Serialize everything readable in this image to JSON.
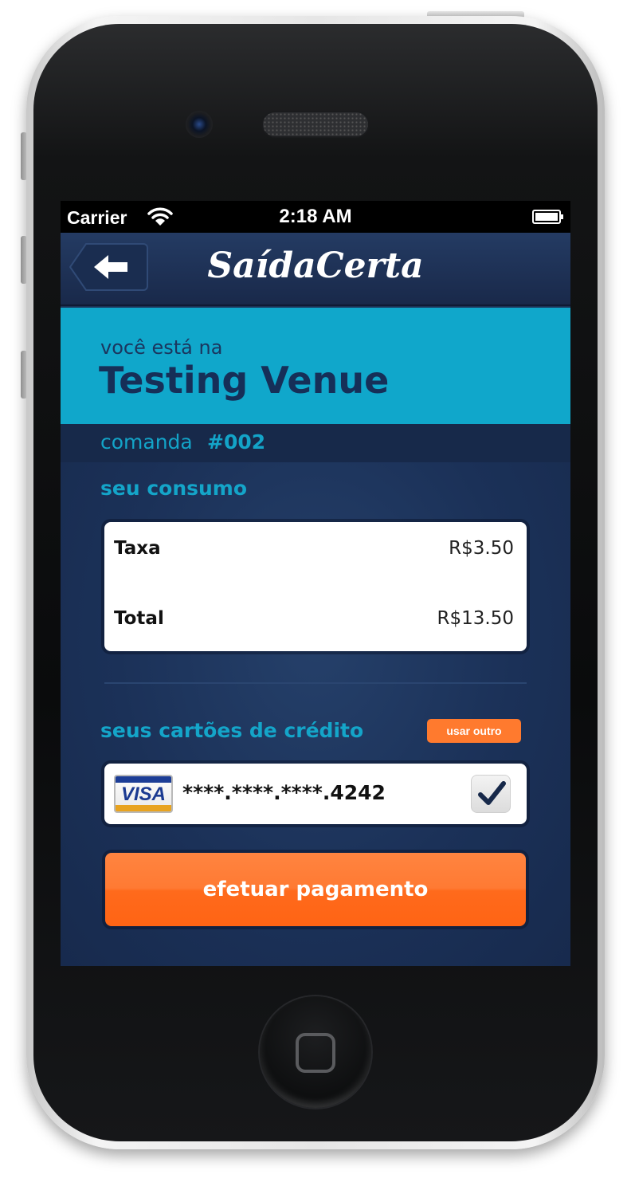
{
  "status_bar": {
    "carrier": "Carrier",
    "time": "2:18 AM",
    "icons": [
      "wifi-icon",
      "battery-icon"
    ]
  },
  "nav": {
    "back_icon": "arrow-left-icon",
    "logo": "SaídaCerta"
  },
  "venue": {
    "prefix": "você está na",
    "name": "Testing Venue"
  },
  "comanda": {
    "label": "comanda",
    "number": "#002"
  },
  "consumo": {
    "title": "seu consumo",
    "rows": [
      {
        "label": "Taxa",
        "value": "R$3.50"
      },
      {
        "label": "Total",
        "value": "R$13.50"
      }
    ]
  },
  "cards": {
    "title": "seus cartões de crédito",
    "use_other_label": "usar outro",
    "items": [
      {
        "brand": "VISA",
        "number": "****.****.****.4242",
        "selected": true
      }
    ]
  },
  "pay_button_label": "efetuar pagamento",
  "colors": {
    "accent_cyan": "#10a7cb",
    "navy": "#1c3256",
    "orange": "#ff7a2e"
  }
}
